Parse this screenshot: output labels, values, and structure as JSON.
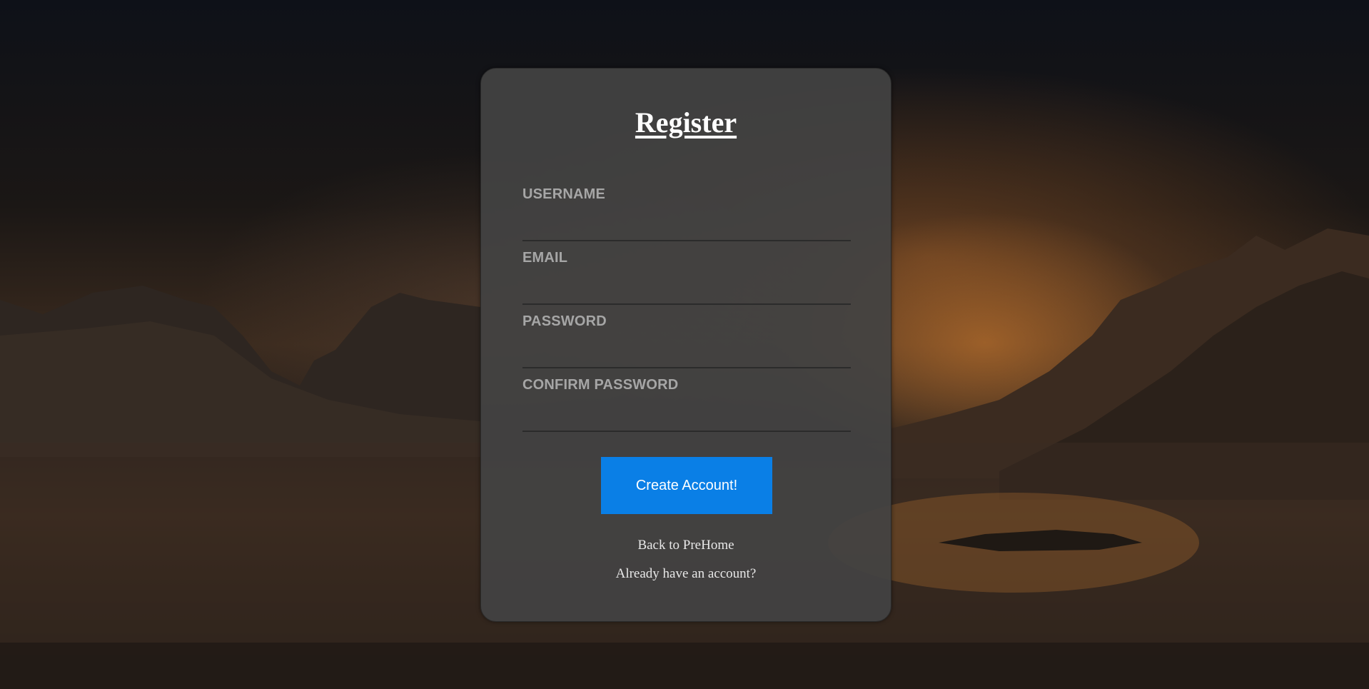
{
  "page": {
    "title": "Register"
  },
  "form": {
    "fields": [
      {
        "label": "USERNAME",
        "value": ""
      },
      {
        "label": "EMAIL",
        "value": ""
      },
      {
        "label": "PASSWORD",
        "value": ""
      },
      {
        "label": "CONFIRM PASSWORD",
        "value": ""
      }
    ],
    "submit_label": "Create Account!",
    "back_link": "Back to PreHome",
    "login_link": "Already have an account?"
  },
  "colors": {
    "accent": "#0a7fe6",
    "card": "#434343",
    "label": "#a6a6a6"
  }
}
